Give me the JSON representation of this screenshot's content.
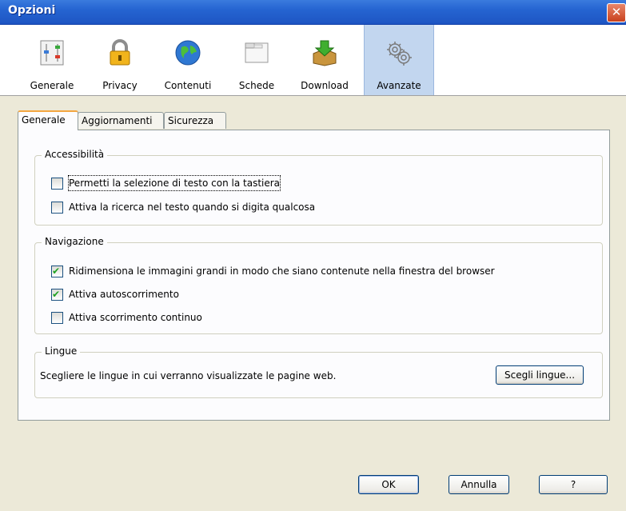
{
  "window": {
    "title": "Opzioni",
    "close_symbol": "✕"
  },
  "toolbar": {
    "items": [
      {
        "label": "Generale",
        "icon": "general-settings-icon"
      },
      {
        "label": "Privacy",
        "icon": "lock-icon"
      },
      {
        "label": "Contenuti",
        "icon": "globe-icon"
      },
      {
        "label": "Schede",
        "icon": "tabs-icon"
      },
      {
        "label": "Download",
        "icon": "download-box-icon"
      },
      {
        "label": "Avanzate",
        "icon": "gears-icon",
        "selected": true
      }
    ]
  },
  "tabs": [
    {
      "label": "Generale",
      "active": true
    },
    {
      "label": "Aggiornamenti",
      "active": false
    },
    {
      "label": "Sicurezza",
      "active": false
    }
  ],
  "accessibility": {
    "legend": "Accessibilità",
    "options": [
      {
        "label": "Permetti la selezione di testo con la tastiera",
        "checked": false
      },
      {
        "label": "Attiva la ricerca nel testo quando si digita qualcosa",
        "checked": false
      }
    ]
  },
  "navigation": {
    "legend": "Navigazione",
    "options": [
      {
        "label": "Ridimensiona le immagini grandi in modo che siano contenute nella finestra del browser",
        "checked": true
      },
      {
        "label": "Attiva autoscorrimento",
        "checked": true
      },
      {
        "label": "Attiva scorrimento continuo",
        "checked": false
      }
    ]
  },
  "languages": {
    "legend": "Lingue",
    "description": "Scegliere le lingue in cui verranno visualizzate le pagine web.",
    "button_label": "Scegli lingue..."
  },
  "footer": {
    "ok_label": "OK",
    "cancel_label": "Annulla",
    "help_label": "?"
  }
}
